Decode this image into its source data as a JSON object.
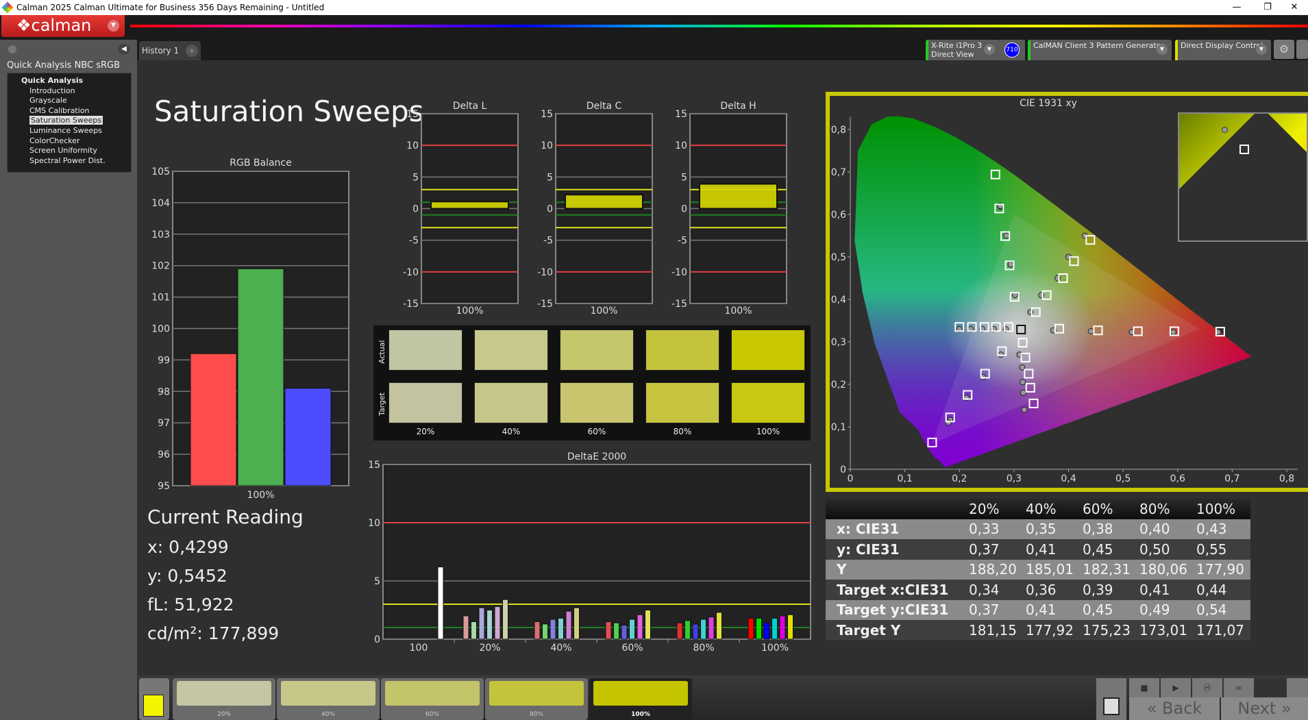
{
  "window": {
    "title": "Calman 2025 Calman Ultimate for Business 356 Days Remaining  - Untitled",
    "minimize": "—",
    "restore": "❐",
    "close": "✕"
  },
  "logo": {
    "text": "calman"
  },
  "sidebar": {
    "title": "Quick Analysis NBC sRGB",
    "root": "Quick Analysis",
    "items": [
      {
        "label": "Introduction"
      },
      {
        "label": "Grayscale"
      },
      {
        "label": "CMS Calibration"
      },
      {
        "label": "Saturation Sweeps",
        "selected": true
      },
      {
        "label": "Luminance Sweeps"
      },
      {
        "label": "ColorChecker"
      },
      {
        "label": "Screen Uniformity"
      },
      {
        "label": "Spectral Power Dist."
      }
    ]
  },
  "tabs": [
    {
      "label": "History 1"
    },
    {
      "label": "+"
    }
  ],
  "devices": {
    "meter": {
      "line1": "X-Rite i1Pro 3",
      "line2": "Direct View",
      "badge": "710"
    },
    "generator": {
      "label": "CalMAN Client 3 Pattern Generator"
    },
    "display": {
      "label": "Direct Display Control"
    }
  },
  "page_title": "Saturation Sweeps",
  "current_reading": {
    "title": "Current Reading",
    "x": "x: 0,4299",
    "y": "y: 0,5452",
    "fl": "fL: 51,922",
    "cdm2": "cd/m²: 177,899"
  },
  "chart_data": [
    {
      "type": "bar",
      "title": "RGB Balance",
      "categories": [
        "100%"
      ],
      "series": [
        {
          "values": [
            99.2
          ],
          "color": "#ff4d4d"
        },
        {
          "values": [
            101.9
          ],
          "color": "#4caf50"
        },
        {
          "values": [
            98.1
          ],
          "color": "#4d4dff"
        }
      ],
      "ylim": [
        95,
        105
      ],
      "yticks": [
        95,
        96,
        97,
        98,
        99,
        100,
        101,
        102,
        103,
        104,
        105
      ]
    },
    {
      "type": "bar",
      "title": "Delta L",
      "categories": [
        "100%"
      ],
      "values": [
        1.1
      ],
      "ylim": [
        -15,
        15
      ],
      "yticks": [
        15,
        10,
        5,
        0,
        -5,
        -10,
        -15
      ],
      "thresholds": {
        "red": [
          10,
          -10
        ],
        "yellow": [
          3,
          -3
        ],
        "green": [
          1,
          -1
        ]
      }
    },
    {
      "type": "bar",
      "title": "Delta C",
      "categories": [
        "100%"
      ],
      "values": [
        2.2
      ],
      "ylim": [
        -15,
        15
      ],
      "yticks": [
        15,
        10,
        5,
        0,
        -5,
        -10,
        -15
      ],
      "thresholds": {
        "red": [
          10,
          -10
        ],
        "yellow": [
          3,
          -3
        ],
        "green": [
          1,
          -1
        ]
      }
    },
    {
      "type": "bar",
      "title": "Delta H",
      "categories": [
        "100%"
      ],
      "values": [
        3.9
      ],
      "ylim": [
        -15,
        15
      ],
      "yticks": [
        15,
        10,
        5,
        0,
        -5,
        -10,
        -15
      ],
      "thresholds": {
        "red": [
          10,
          -10
        ],
        "yellow": [
          3,
          -3
        ],
        "green": [
          1,
          -1
        ]
      }
    },
    {
      "type": "bar",
      "title": "DeltaE 2000",
      "categories": [
        "100",
        "20%",
        "40%",
        "60%",
        "80%",
        "100%"
      ],
      "ylim": [
        0,
        15
      ],
      "yticks": [
        0,
        5,
        10,
        15
      ],
      "thresholds": {
        "red": 10,
        "yellow": 3,
        "green": 1
      },
      "groups": [
        [
          6.2
        ],
        [
          2.0,
          1.5,
          2.7,
          2.5,
          2.8,
          3.4
        ],
        [
          1.5,
          1.3,
          1.7,
          1.8,
          2.4,
          2.7
        ],
        [
          1.5,
          1.4,
          1.2,
          1.7,
          2.1,
          2.5
        ],
        [
          1.4,
          1.6,
          1.3,
          1.7,
          1.9,
          2.3
        ],
        [
          1.8,
          1.8,
          1.4,
          1.8,
          2.0,
          2.1
        ]
      ],
      "group_colors": [
        [
          "#ffffff"
        ],
        [
          "#d89a9a",
          "#a8d8a8",
          "#a8a8d8",
          "#a8d0d0",
          "#d0a8d0",
          "#d0d0a8"
        ],
        [
          "#d87070",
          "#70d870",
          "#8080e0",
          "#80d0d0",
          "#d080d0",
          "#d0d080"
        ],
        [
          "#e05050",
          "#50d050",
          "#6060e0",
          "#60d0d0",
          "#e060e0",
          "#e0e060"
        ],
        [
          "#e03030",
          "#30d030",
          "#4040e0",
          "#40d0d0",
          "#e040e0",
          "#e0e040"
        ],
        [
          "#ff0000",
          "#00dd00",
          "#0000ff",
          "#00d0d0",
          "#e000e0",
          "#e0e000"
        ]
      ]
    },
    {
      "type": "scatter",
      "title": "CIE 1931 xy",
      "xlim": [
        0,
        0.8
      ],
      "ylim": [
        0,
        0.85
      ],
      "xticks": [
        0,
        0.1,
        0.2,
        0.3,
        0.4,
        0.5,
        0.6,
        0.7,
        0.8
      ],
      "yticks": [
        0,
        0.1,
        0.2,
        0.3,
        0.4,
        0.5,
        0.6,
        0.7,
        0.8
      ],
      "tick_labels_x": [
        "0",
        "0,1",
        "0,2",
        "0,3",
        "0,4",
        "0,5",
        "0,6",
        "0,7",
        "0,8"
      ],
      "tick_labels_y": [
        "0",
        "0,1",
        "0,2",
        "0,3",
        "0,4",
        "0,5",
        "0,6",
        "0,7",
        "0,8"
      ],
      "white": [
        0.313,
        0.329
      ],
      "targets": {
        "red": [
          [
            0.383,
            0.331
          ],
          [
            0.454,
            0.327
          ],
          [
            0.527,
            0.325
          ],
          [
            0.594,
            0.325
          ],
          [
            0.678,
            0.324
          ]
        ],
        "green": [
          [
            0.301,
            0.406
          ],
          [
            0.292,
            0.48
          ],
          [
            0.284,
            0.549
          ],
          [
            0.273,
            0.614
          ],
          [
            0.266,
            0.694
          ]
        ],
        "blue": [
          [
            0.278,
            0.278
          ],
          [
            0.247,
            0.225
          ],
          [
            0.215,
            0.175
          ],
          [
            0.183,
            0.122
          ],
          [
            0.15,
            0.063
          ]
        ],
        "cyan": [
          [
            0.29,
            0.335
          ],
          [
            0.267,
            0.335
          ],
          [
            0.246,
            0.335
          ],
          [
            0.223,
            0.335
          ],
          [
            0.2,
            0.335
          ]
        ],
        "magenta": [
          [
            0.316,
            0.298
          ],
          [
            0.321,
            0.263
          ],
          [
            0.327,
            0.225
          ],
          [
            0.33,
            0.192
          ],
          [
            0.336,
            0.155
          ]
        ],
        "yellow": [
          [
            0.34,
            0.37
          ],
          [
            0.36,
            0.41
          ],
          [
            0.39,
            0.45
          ],
          [
            0.41,
            0.49
          ],
          [
            0.44,
            0.54
          ]
        ]
      },
      "measured": {
        "red": [
          [
            0.372,
            0.327
          ],
          [
            0.441,
            0.325
          ],
          [
            0.516,
            0.323
          ],
          [
            0.592,
            0.323
          ],
          [
            0.674,
            0.323
          ]
        ],
        "green": [
          [
            0.302,
            0.41
          ],
          [
            0.294,
            0.482
          ],
          [
            0.286,
            0.55
          ],
          [
            0.276,
            0.618
          ],
          [
            0.275,
            0.62
          ]
        ],
        "blue": [
          [
            0.276,
            0.27
          ],
          [
            0.243,
            0.217
          ],
          [
            0.213,
            0.168
          ],
          [
            0.183,
            0.116
          ],
          [
            0.18,
            0.11
          ]
        ],
        "cyan": [
          [
            0.285,
            0.33
          ],
          [
            0.263,
            0.33
          ],
          [
            0.242,
            0.33
          ],
          [
            0.221,
            0.33
          ],
          [
            0.2,
            0.33
          ]
        ],
        "magenta": [
          [
            0.31,
            0.27
          ],
          [
            0.315,
            0.24
          ],
          [
            0.316,
            0.205
          ],
          [
            0.317,
            0.18
          ],
          [
            0.319,
            0.14
          ]
        ],
        "yellow": [
          [
            0.33,
            0.37
          ],
          [
            0.35,
            0.41
          ],
          [
            0.38,
            0.45
          ],
          [
            0.4,
            0.5
          ],
          [
            0.43,
            0.55
          ]
        ]
      }
    }
  ],
  "swatches": {
    "row_labels": [
      "Actual",
      "Target"
    ],
    "labels": [
      "20%",
      "40%",
      "60%",
      "80%",
      "100%"
    ],
    "actual": [
      "#c0c6a4",
      "#c6c88c",
      "#c6c66c",
      "#c4c43c",
      "#c8c800"
    ],
    "target": [
      "#c4c3a0",
      "#c7c68a",
      "#c8c56e",
      "#c6c43e",
      "#c8c810"
    ]
  },
  "table": {
    "headers": [
      "",
      "20%",
      "40%",
      "60%",
      "80%",
      "100%"
    ],
    "rows": [
      [
        "x: CIE31",
        "0,33",
        "0,35",
        "0,38",
        "0,40",
        "0,43"
      ],
      [
        "y: CIE31",
        "0,37",
        "0,41",
        "0,45",
        "0,50",
        "0,55"
      ],
      [
        "Y",
        "188,20",
        "185,01",
        "182,31",
        "180,06",
        "177,90"
      ],
      [
        "Target x:CIE31",
        "0,34",
        "0,36",
        "0,39",
        "0,41",
        "0,44"
      ],
      [
        "Target y:CIE31",
        "0,37",
        "0,41",
        "0,45",
        "0,49",
        "0,54"
      ],
      [
        "Target Y",
        "181,15",
        "177,92",
        "175,23",
        "173,01",
        "171,07"
      ]
    ]
  },
  "bottom": {
    "current_color": "#f4f400",
    "swatches": [
      {
        "label": "20%",
        "color": "#c4c6a4"
      },
      {
        "label": "40%",
        "color": "#c6c88a"
      },
      {
        "label": "60%",
        "color": "#c4c46a"
      },
      {
        "label": "80%",
        "color": "#c4c43c"
      },
      {
        "label": "100%",
        "color": "#c4c400"
      }
    ],
    "back": "Back",
    "next": "Next"
  }
}
